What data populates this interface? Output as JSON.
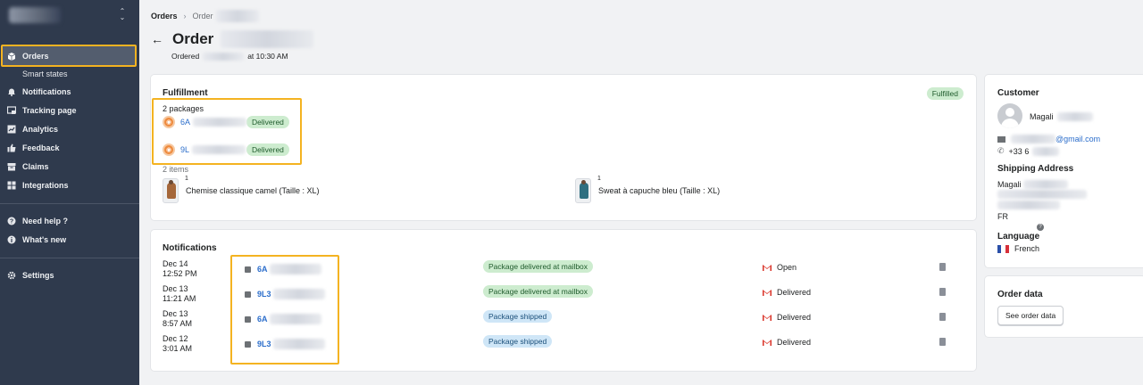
{
  "sidebar": {
    "nav": [
      {
        "label": "Orders",
        "icon": "orders-icon",
        "active": true
      },
      {
        "label": "Smart states",
        "sub": true
      },
      {
        "label": "Notifications",
        "icon": "bell-icon"
      },
      {
        "label": "Tracking page",
        "icon": "tracking-page-icon"
      },
      {
        "label": "Analytics",
        "icon": "analytics-icon"
      },
      {
        "label": "Feedback",
        "icon": "thumbs-up-icon"
      },
      {
        "label": "Claims",
        "icon": "claims-icon"
      },
      {
        "label": "Integrations",
        "icon": "integrations-icon"
      },
      {
        "label": "Need help ?",
        "icon": "help-icon"
      },
      {
        "label": "What's new",
        "icon": "info-icon"
      },
      {
        "label": "Settings",
        "icon": "gear-icon"
      }
    ]
  },
  "breadcrumb": {
    "root": "Orders",
    "current": "Order"
  },
  "header": {
    "title": "Order",
    "ordered_prefix": "Ordered",
    "ordered_time": "at 10:30 AM"
  },
  "fulfillment": {
    "title": "Fulfillment",
    "status": "Fulfilled",
    "packages_count": "2 packages",
    "packages": [
      {
        "tracking": "6A",
        "status": "Delivered"
      },
      {
        "tracking": "9L",
        "status": "Delivered"
      }
    ],
    "items_count": "2 items",
    "items": [
      {
        "name": "Chemise classique camel (Taille : XL)",
        "qty": "1",
        "color": "#a5673a"
      },
      {
        "name": "Sweat à capuche bleu (Taille : XL)",
        "qty": "1",
        "color": "#2f6f80"
      }
    ]
  },
  "notifications": {
    "title": "Notifications",
    "rows": [
      {
        "date": "Dec 14",
        "time": "12:52 PM",
        "tracking": "6A",
        "status": "Package delivered at mailbox",
        "status_type": "green",
        "email_status": "Open"
      },
      {
        "date": "Dec 13",
        "time": "11:21 AM",
        "tracking": "9L3",
        "status": "Package delivered at mailbox",
        "status_type": "green",
        "email_status": "Delivered"
      },
      {
        "date": "Dec 13",
        "time": "8:57 AM",
        "tracking": "6A",
        "status": "Package shipped",
        "status_type": "blue",
        "email_status": "Delivered"
      },
      {
        "date": "Dec 12",
        "time": "3:01 AM",
        "tracking": "9L3",
        "status": "Package shipped",
        "status_type": "blue",
        "email_status": "Delivered"
      }
    ]
  },
  "customer": {
    "title": "Customer",
    "name": "Magali",
    "email_suffix": "@gmail.com",
    "phone": "+33 6",
    "shipping_title": "Shipping Address",
    "address_name": "Magali",
    "country": "FR",
    "language_title": "Language",
    "language": "French"
  },
  "order_data": {
    "title": "Order data",
    "button": "See order data"
  },
  "colors": {
    "sidebar_bg": "#2f3a4d",
    "highlight": "#f4b321",
    "link": "#2c6ecb"
  }
}
